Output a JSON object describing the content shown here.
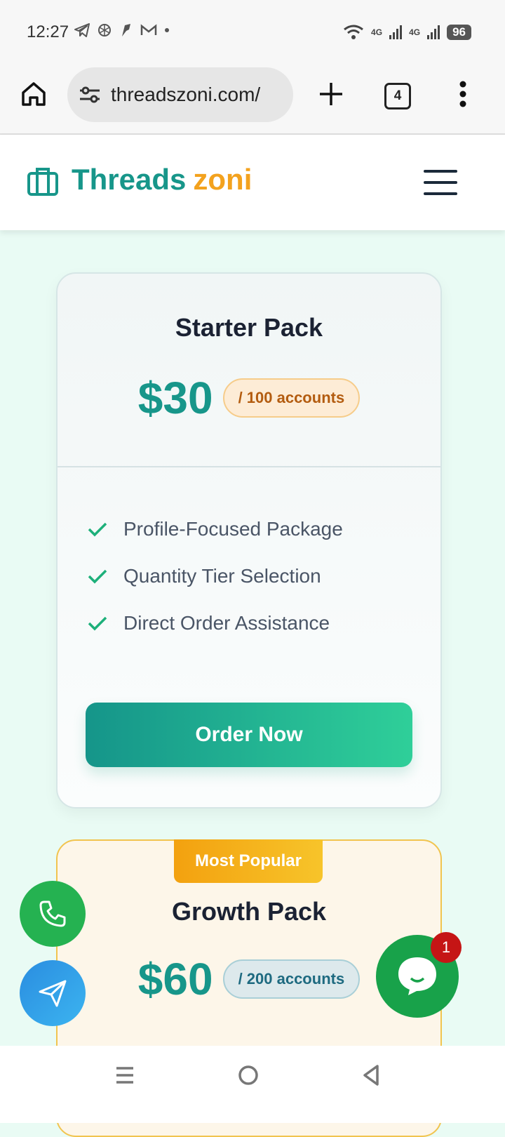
{
  "status_bar": {
    "time": "12:27",
    "signal_1": "4G",
    "signal_2": "4G",
    "battery": "96"
  },
  "browser": {
    "url": "threadszoni.com/",
    "tab_count": "4"
  },
  "site": {
    "brand_part1": "Threads",
    "brand_part2": "zoni"
  },
  "cards": [
    {
      "title": "Starter Pack",
      "price": "$30",
      "unit": "/ 100 accounts",
      "features": [
        "Profile-Focused Package",
        "Quantity Tier Selection",
        "Direct Order Assistance"
      ],
      "button": "Order Now"
    },
    {
      "badge": "Most Popular",
      "title": "Growth Pack",
      "price": "$60",
      "unit": "/ 200 accounts"
    }
  ],
  "chat": {
    "notification_count": "1"
  },
  "colors": {
    "brand_teal": "#17968a",
    "brand_orange": "#f3a21e",
    "whatsapp_green": "#18a24a",
    "phone_green": "#25b251",
    "send_blue": "#2a8de0",
    "badge_red": "#c51515"
  },
  "icons": {
    "status_left": [
      "telegram-icon",
      "openai-icon",
      "app-icon",
      "gmail-icon",
      "dot-icon"
    ],
    "status_right": [
      "wifi-icon",
      "signal-icon",
      "signal-icon",
      "battery-icon"
    ],
    "browser": [
      "home-icon",
      "tune-icon",
      "plus-icon",
      "tabs-icon",
      "more-vert-icon"
    ],
    "site": [
      "briefcase-icon",
      "hamburger-icon"
    ],
    "floating": [
      "phone-icon",
      "send-icon",
      "chat-icon"
    ],
    "nav": [
      "recents-icon",
      "home-circle-icon",
      "back-icon"
    ]
  }
}
